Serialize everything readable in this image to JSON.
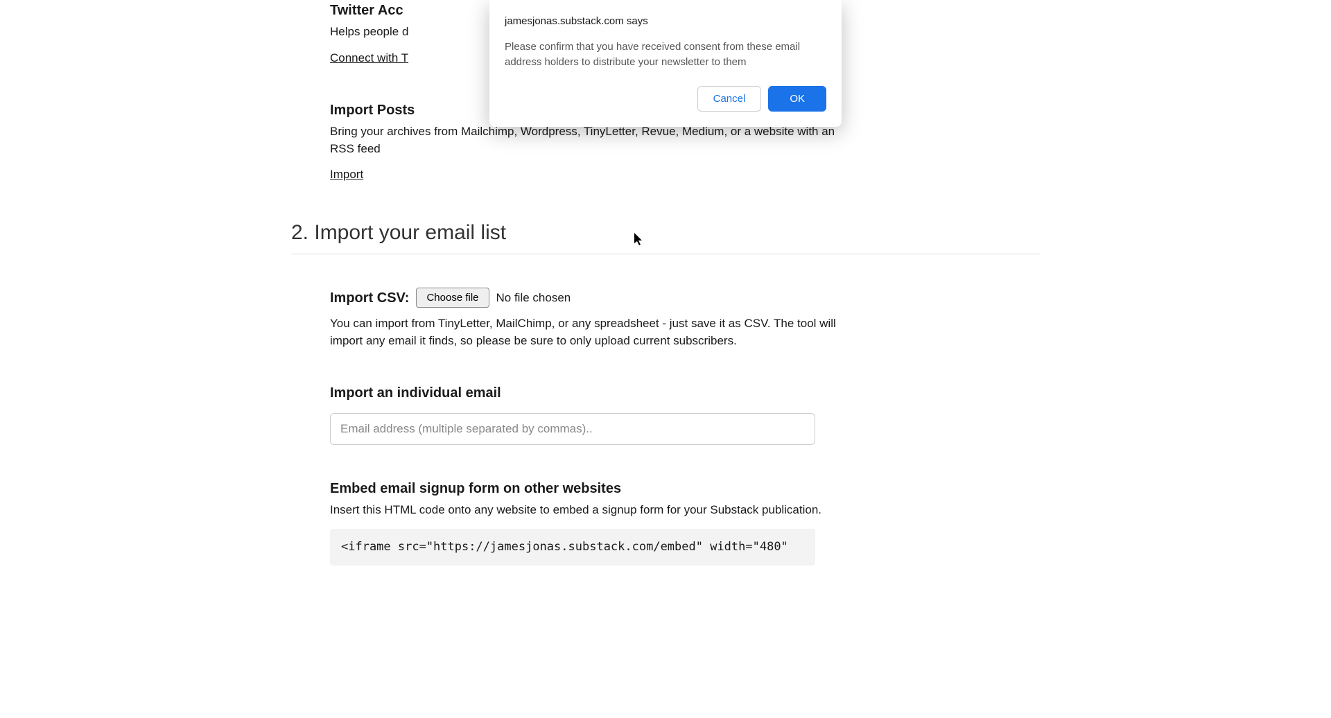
{
  "dialog": {
    "title": "jamesjonas.substack.com says",
    "message": "Please confirm that you have received consent from these email address holders to distribute your newsletter to them",
    "cancel": "Cancel",
    "ok": "OK"
  },
  "twitter": {
    "heading": "Twitter Acc",
    "desc_visible": "Helps people d",
    "link": "Connect with T"
  },
  "import_posts": {
    "heading": "Import Posts",
    "desc": "Bring your archives from Mailchimp, Wordpress, TinyLetter, Revue, Medium, or a website with an RSS feed",
    "link": "Import"
  },
  "step2": {
    "heading": "2. Import your email list"
  },
  "import_csv": {
    "label": "Import CSV:",
    "button": "Choose file",
    "status": "No file chosen",
    "desc": "You can import from TinyLetter, MailChimp, or any spreadsheet - just save it as CSV. The tool will import any email it finds, so please be sure to only upload current subscribers."
  },
  "import_email": {
    "heading": "Import an individual email",
    "placeholder": "Email address (multiple separated by commas).."
  },
  "embed": {
    "heading": "Embed email signup form on other websites",
    "desc": "Insert this HTML code onto any website to embed a signup form for your Substack publication.",
    "code": "<iframe src=\"https://jamesjonas.substack.com/embed\" width=\"480\""
  }
}
